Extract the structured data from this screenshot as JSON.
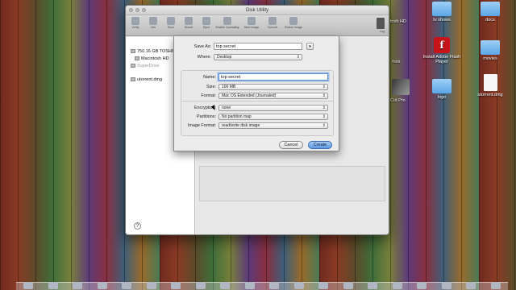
{
  "window": {
    "title": "Disk Utility",
    "toolbar": [
      "Verify",
      "Info",
      "Burn",
      "Mount",
      "Eject",
      "Enable Journaling",
      "New Image",
      "Convert",
      "Resize Image"
    ],
    "log_label": "Log"
  },
  "sidebar": {
    "disks": [
      {
        "label": "750.16 GB TOSHIBA",
        "indent": false,
        "dim": false
      },
      {
        "label": "Macintosh HD",
        "indent": true,
        "dim": false
      },
      {
        "label": "SuperDrive",
        "indent": false,
        "dim": true
      }
    ],
    "image": "utorrent.dmg",
    "help": "?"
  },
  "sheet": {
    "save_as_label": "Save As:",
    "save_as_value": "top secret",
    "expand": "▾",
    "where_label": "Where:",
    "where_value": "Desktop",
    "name_label": "Name:",
    "name_value": "top secret",
    "size_label": "Size:",
    "size_value": "100 MB",
    "format_label": "Format:",
    "format_value": "Mac OS Extended (Journaled)",
    "encryption_label": "Encryption:",
    "encryption_value": "none",
    "partitions_label": "Partitions:",
    "partitions_value": "No partition map",
    "image_format_label": "Image Format:",
    "image_format_value": "read/write disk image",
    "cancel": "Cancel",
    "create": "Create"
  },
  "desktop": {
    "partial_labels": [
      "tosh HD",
      "mes",
      "Cut Pro"
    ],
    "icons": [
      {
        "label": "tv shows",
        "kind": "folder"
      },
      {
        "label": "docs",
        "kind": "folder"
      },
      {
        "label": "Install Adobe Flash Player",
        "kind": "flash"
      },
      {
        "label": "movies",
        "kind": "folder"
      },
      {
        "label": "logo",
        "kind": "folder"
      },
      {
        "label": "utorrent.dmg",
        "kind": "file"
      }
    ]
  },
  "colors": {
    "accent": "#5c98e3",
    "focus_ring": "#5a8fd6",
    "flash_red": "#c7141a",
    "folder_blue": "#5aa6e6"
  }
}
